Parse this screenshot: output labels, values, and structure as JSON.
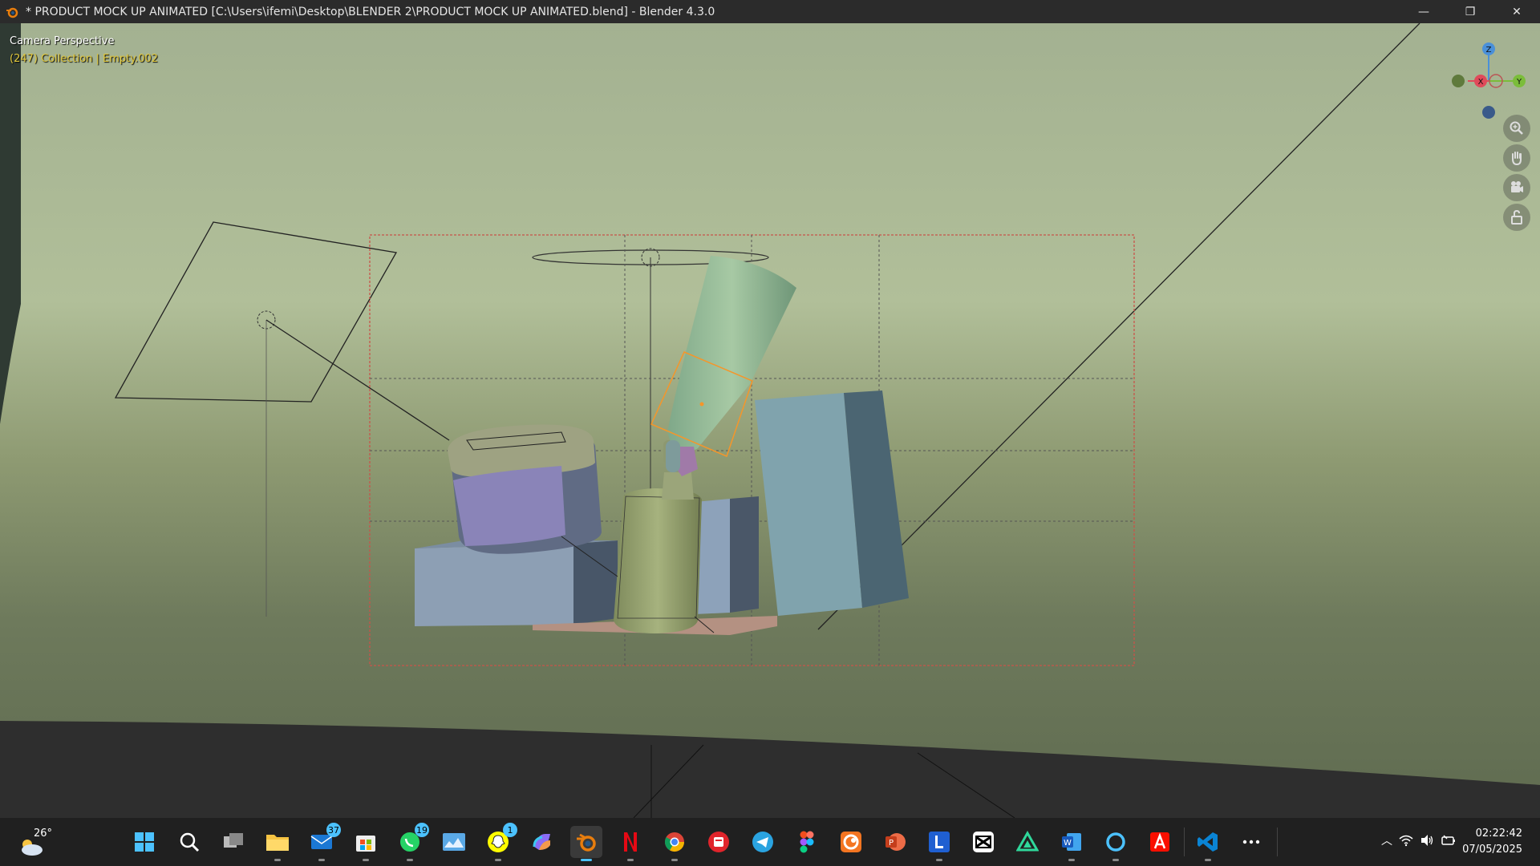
{
  "window": {
    "title": "* PRODUCT MOCK UP ANIMATED [C:\\Users\\ifemi\\Desktop\\BLENDER 2\\PRODUCT MOCK UP ANIMATED.blend] - Blender 4.3.0",
    "app_icon": "blender-icon",
    "controls": {
      "minimize": "—",
      "maximize": "❐",
      "close": "✕"
    }
  },
  "viewport": {
    "view_name": "Camera Perspective",
    "object_info": "(247) Collection | Empty.002",
    "gizmo": {
      "z": "Z",
      "x": "X",
      "y": "Y"
    },
    "nav_tools": [
      "zoom-icon",
      "pan-hand-icon",
      "camera-view-icon",
      "lock-icon"
    ],
    "colors": {
      "background": "#a9b58f",
      "floor": "#2e2e2e",
      "camera_border": "#c8544a",
      "selection": "#f5962a"
    }
  },
  "taskbar": {
    "weather": {
      "temp": "26°",
      "icon": "partly-cloudy-icon"
    },
    "apps": [
      {
        "name": "start-icon"
      },
      {
        "name": "search-icon"
      },
      {
        "name": "task-view-icon"
      },
      {
        "name": "file-explorer-icon"
      },
      {
        "name": "mail-icon",
        "badge": "37"
      },
      {
        "name": "microsoft-store-icon"
      },
      {
        "name": "whatsapp-icon",
        "badge": "19"
      },
      {
        "name": "photos-icon"
      },
      {
        "name": "snapchat-icon",
        "badge": "1"
      },
      {
        "name": "copilot-icon"
      },
      {
        "name": "blender-icon",
        "active": true
      },
      {
        "name": "netflix-icon"
      },
      {
        "name": "chrome-icon"
      },
      {
        "name": "pdf-icon"
      },
      {
        "name": "telegram-icon"
      },
      {
        "name": "figma-icon"
      },
      {
        "name": "crunchyroll-icon"
      },
      {
        "name": "powerpoint-icon"
      },
      {
        "name": "l-app-icon"
      },
      {
        "name": "capcut-icon"
      },
      {
        "name": "triangle-app-icon"
      },
      {
        "name": "word-icon"
      },
      {
        "name": "cortana-icon"
      },
      {
        "name": "acrobat-icon"
      },
      {
        "name": "vscode-icon"
      },
      {
        "name": "more-icon"
      }
    ],
    "clock": {
      "time": "02:22:42",
      "date": "07/05/2025"
    }
  }
}
